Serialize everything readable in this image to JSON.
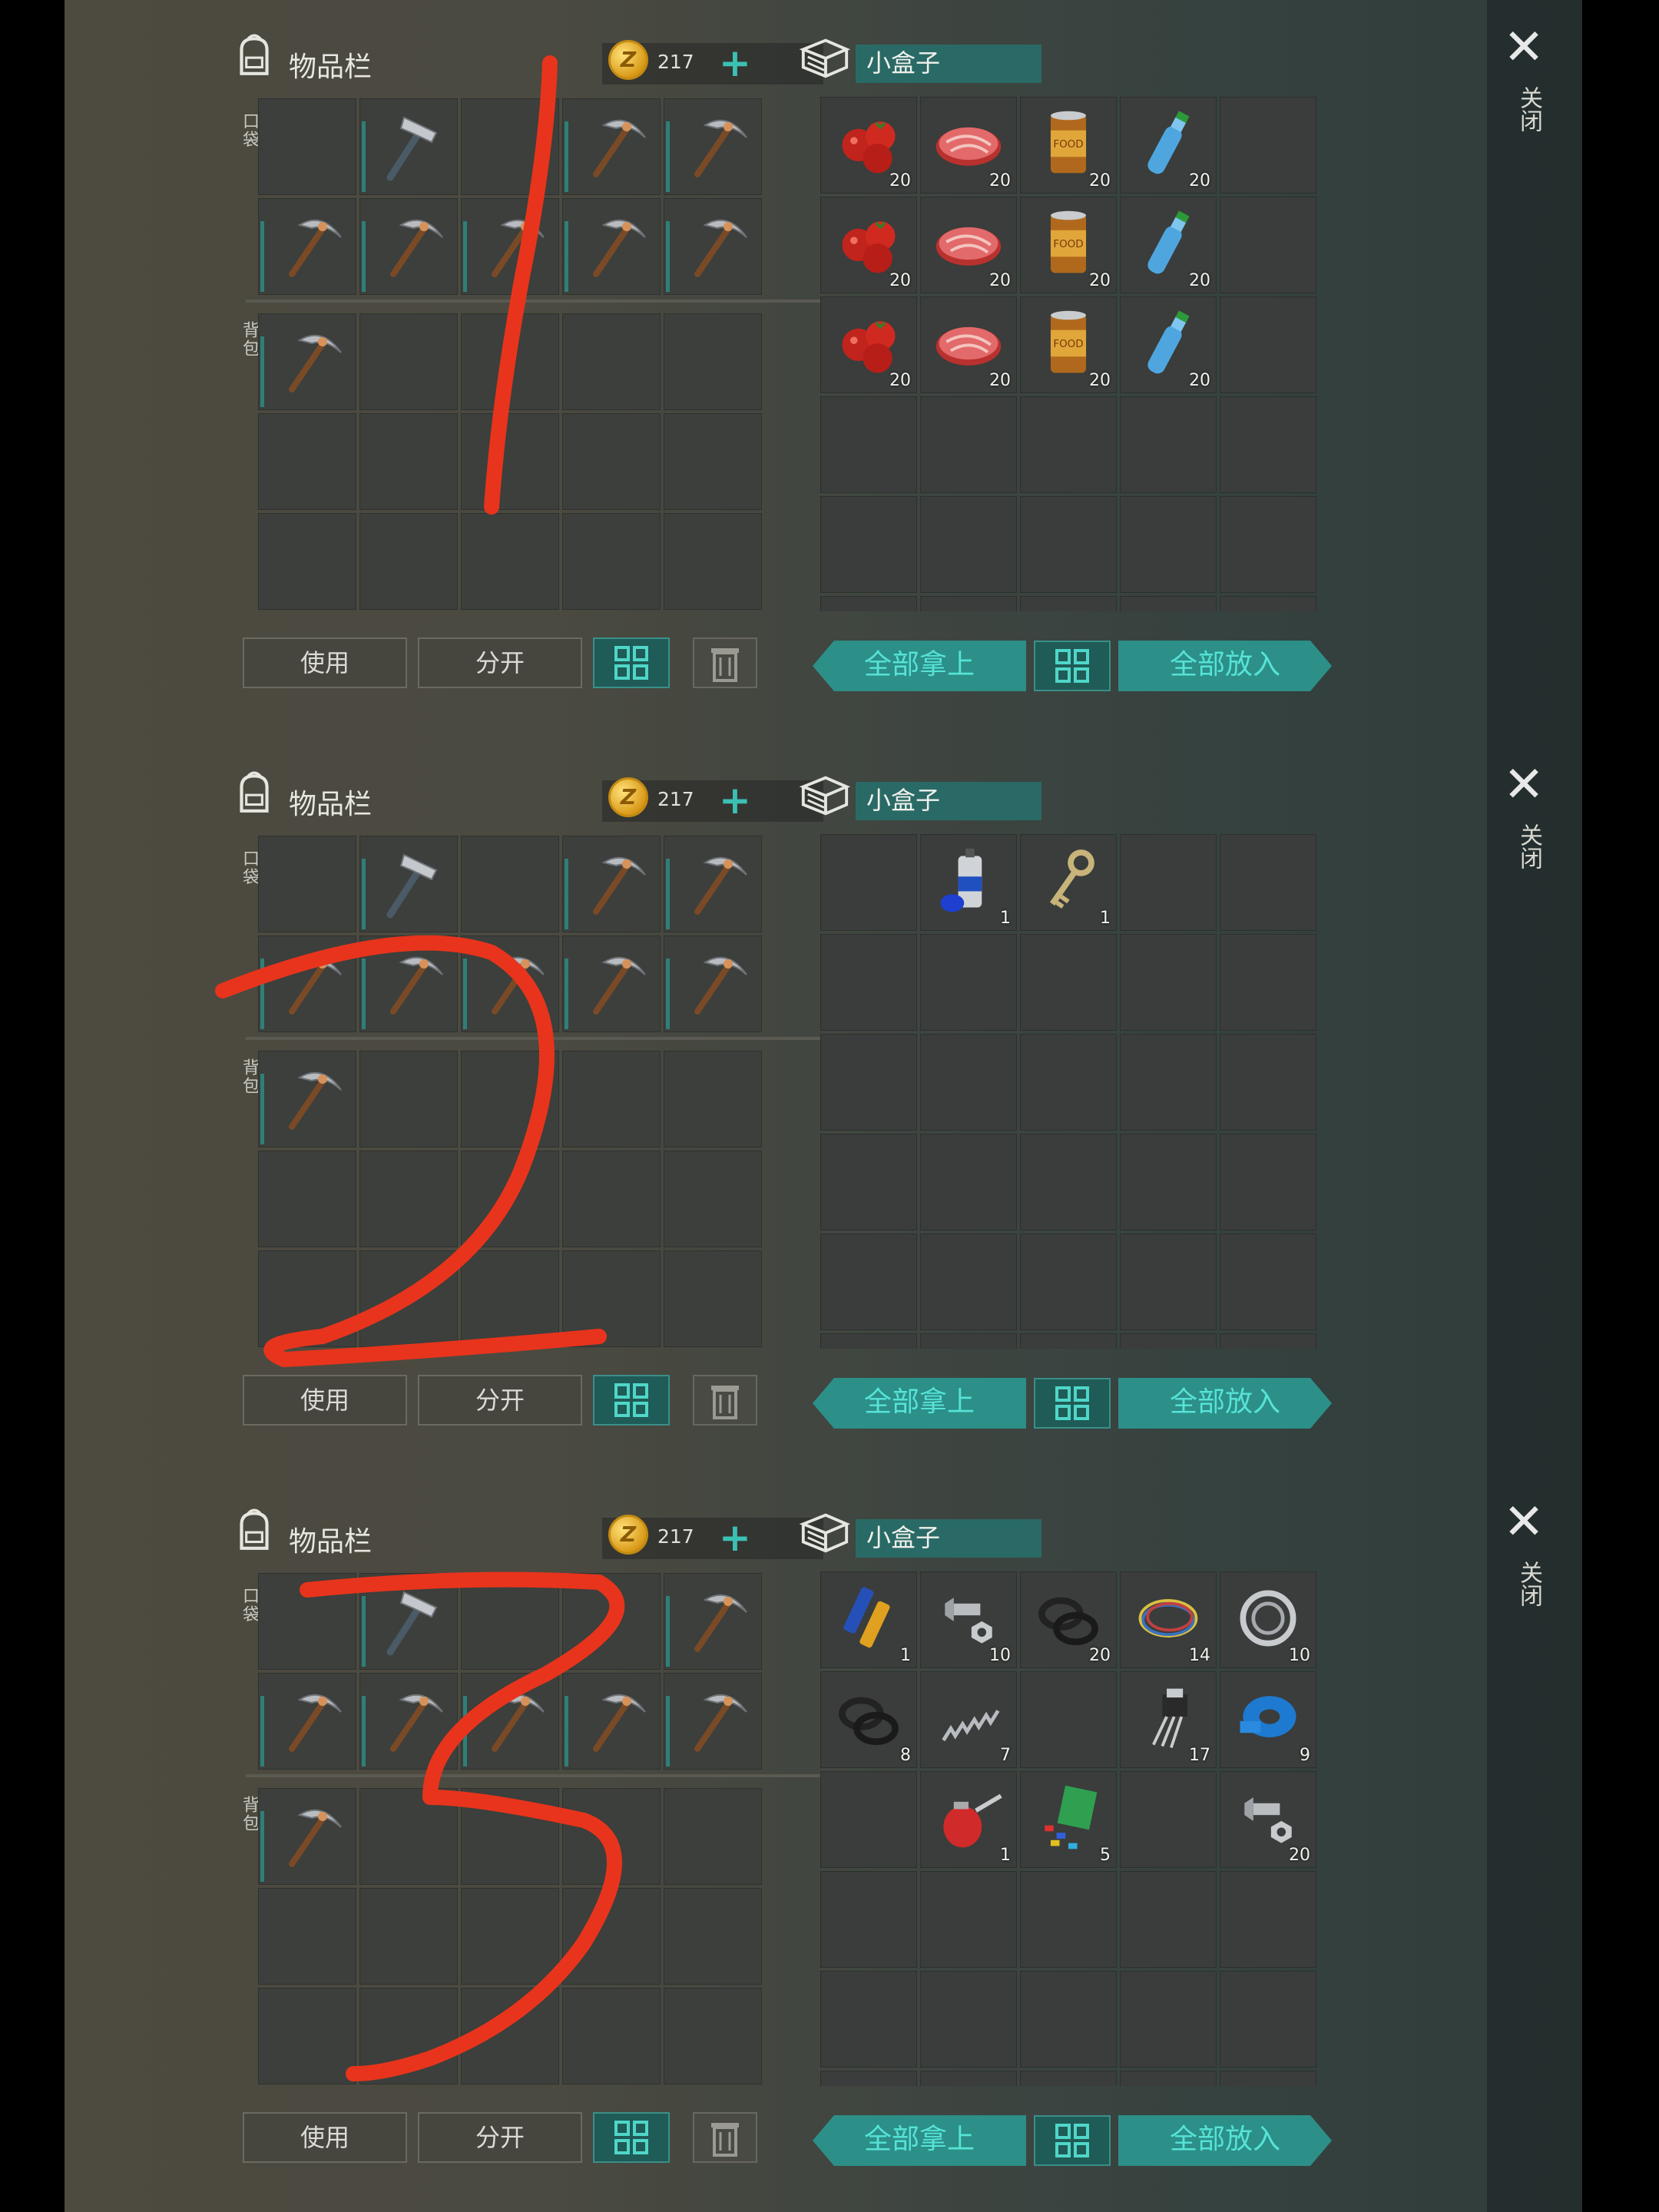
{
  "colors": {
    "accent": "#2c8f88",
    "scribble": "#e8341c"
  },
  "panels": [
    {
      "inventory": {
        "title": "物品栏",
        "coins": "217",
        "pocket_label": "口袋",
        "backpack_label": "背包",
        "pocket": [
          "",
          "hammer",
          "",
          "pickaxe",
          "pickaxe",
          "pickaxe",
          "pickaxe",
          "pickaxe",
          "pickaxe",
          "pickaxe"
        ],
        "backpack": [
          "pickaxe",
          "",
          "",
          "",
          "",
          "",
          "",
          "",
          "",
          "",
          "",
          "",
          "",
          "",
          ""
        ]
      },
      "box": {
        "title": "小盒子",
        "items": [
          [
            "tomatoes",
            "20"
          ],
          [
            "steak",
            "20"
          ],
          [
            "canned-food",
            "20"
          ],
          [
            "water-bottle",
            "20"
          ],
          [
            "",
            ""
          ],
          [
            "tomatoes",
            "20"
          ],
          [
            "steak",
            "20"
          ],
          [
            "canned-food",
            "20"
          ],
          [
            "water-bottle",
            "20"
          ],
          [
            "",
            ""
          ],
          [
            "tomatoes",
            "20"
          ],
          [
            "steak",
            "20"
          ],
          [
            "canned-food",
            "20"
          ],
          [
            "water-bottle",
            "20"
          ],
          [
            "",
            ""
          ]
        ]
      },
      "buttons": {
        "use": "使用",
        "split": "分开",
        "take_all": "全部拿上",
        "put_all": "全部放入"
      },
      "close_label": "关闭",
      "scribble": "1"
    },
    {
      "inventory": {
        "title": "物品栏",
        "coins": "217",
        "pocket_label": "口袋",
        "backpack_label": "背包",
        "pocket": [
          "",
          "hammer",
          "",
          "pickaxe",
          "pickaxe",
          "pickaxe",
          "pickaxe",
          "pickaxe",
          "pickaxe",
          "pickaxe"
        ],
        "backpack": [
          "pickaxe",
          "",
          "",
          "",
          "",
          "",
          "",
          "",
          "",
          "",
          "",
          "",
          "",
          "",
          ""
        ]
      },
      "box": {
        "title": "小盒子",
        "items": [
          [
            "",
            ""
          ],
          [
            "spray-can",
            "1"
          ],
          [
            "key",
            "1"
          ],
          [
            "",
            ""
          ],
          [
            "",
            ""
          ]
        ]
      },
      "buttons": {
        "use": "使用",
        "split": "分开",
        "take_all": "全部拿上",
        "put_all": "全部放入"
      },
      "close_label": "关闭",
      "scribble": "2"
    },
    {
      "inventory": {
        "title": "物品栏",
        "coins": "217",
        "pocket_label": "口袋",
        "backpack_label": "背包",
        "pocket": [
          "",
          "hammer",
          "",
          "",
          "pickaxe",
          "pickaxe",
          "pickaxe",
          "pickaxe",
          "pickaxe",
          "pickaxe"
        ],
        "backpack": [
          "pickaxe",
          "",
          "",
          "",
          "",
          "",
          "",
          "",
          "",
          "",
          "",
          "",
          "",
          "",
          ""
        ]
      },
      "box": {
        "title": "小盒子",
        "items": [
          [
            "batteries",
            "1"
          ],
          [
            "bolt-nut",
            "10"
          ],
          [
            "rubber-rings",
            "20"
          ],
          [
            "wires",
            "14"
          ],
          [
            "bearing",
            "10"
          ],
          [
            "rubber-rings",
            "8"
          ],
          [
            "spring",
            "7"
          ],
          [
            "",
            ""
          ],
          [
            "transistor",
            "17"
          ],
          [
            "tape",
            "9"
          ],
          [
            "",
            ""
          ],
          [
            "oil-can",
            "1"
          ],
          [
            "electronics",
            "5"
          ],
          [
            "",
            ""
          ],
          [
            "bolt-nut",
            "20"
          ]
        ]
      },
      "buttons": {
        "use": "使用",
        "split": "分开",
        "take_all": "全部拿上",
        "put_all": "全部放入"
      },
      "close_label": "关闭",
      "scribble": "3"
    }
  ]
}
